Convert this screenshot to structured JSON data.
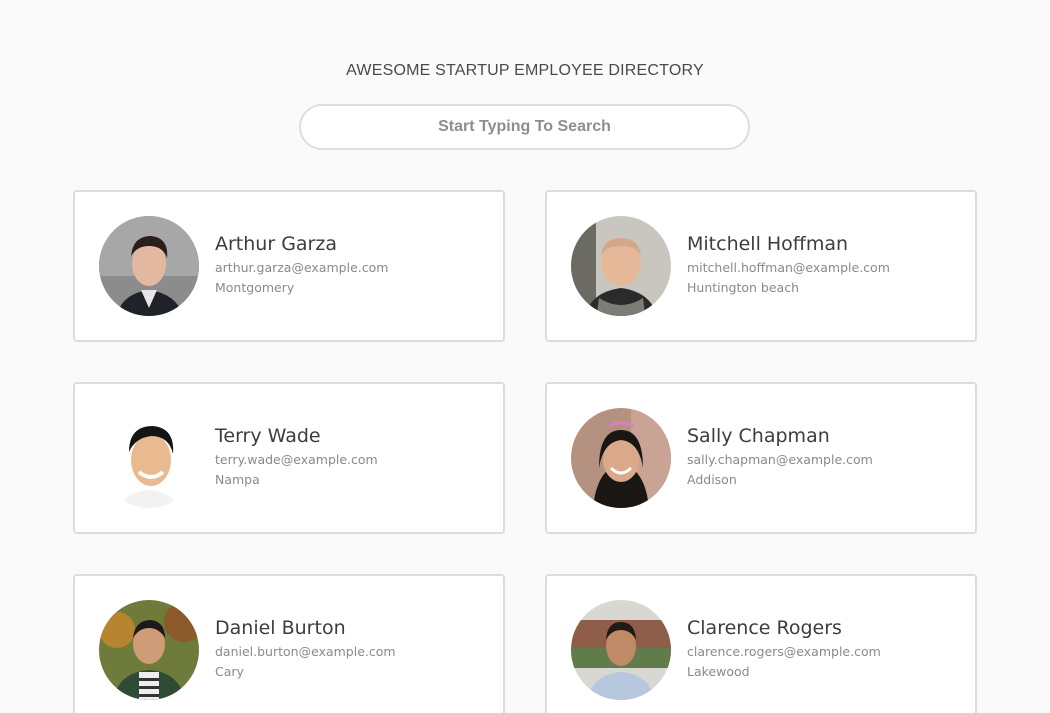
{
  "header": {
    "title": "AWESOME STARTUP EMPLOYEE DIRECTORY"
  },
  "search": {
    "placeholder": "Start Typing To Search"
  },
  "employees": [
    {
      "name": "Arthur Garza",
      "email": "arthur.garza@example.com",
      "city": "Montgomery"
    },
    {
      "name": "Mitchell Hoffman",
      "email": "mitchell.hoffman@example.com",
      "city": "Huntington beach"
    },
    {
      "name": "Terry Wade",
      "email": "terry.wade@example.com",
      "city": "Nampa"
    },
    {
      "name": "Sally Chapman",
      "email": "sally.chapman@example.com",
      "city": "Addison"
    },
    {
      "name": "Daniel Burton",
      "email": "daniel.burton@example.com",
      "city": "Cary"
    },
    {
      "name": "Clarence Rogers",
      "email": "clarence.rogers@example.com",
      "city": "Lakewood"
    }
  ]
}
